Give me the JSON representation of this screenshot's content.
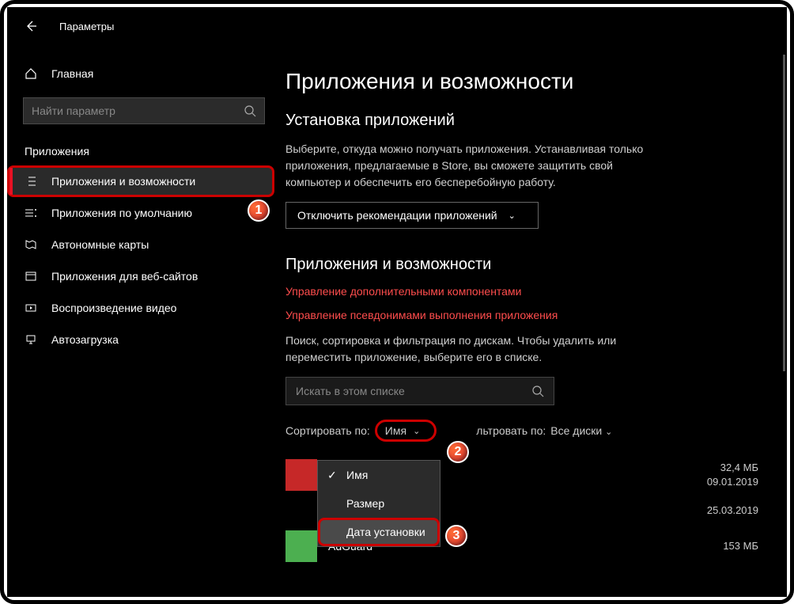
{
  "window": {
    "title": "Параметры"
  },
  "sidebar": {
    "home": "Главная",
    "search_placeholder": "Найти параметр",
    "section": "Приложения",
    "items": [
      {
        "label": "Приложения и возможности"
      },
      {
        "label": "Приложения по умолчанию"
      },
      {
        "label": "Автономные карты"
      },
      {
        "label": "Приложения для веб-сайтов"
      },
      {
        "label": "Воспроизведение видео"
      },
      {
        "label": "Автозагрузка"
      }
    ]
  },
  "main": {
    "title": "Приложения и возможности",
    "install": {
      "heading": "Установка приложений",
      "description": "Выберите, откуда можно получать приложения. Устанавливая только приложения, предлагаемые в Store, вы сможете защитить свой компьютер и обеспечить его бесперебойную работу.",
      "dropdown": "Отключить рекомендации приложений"
    },
    "apps": {
      "heading": "Приложения и возможности",
      "link1": "Управление дополнительными компонентами",
      "link2": "Управление псевдонимами выполнения приложения",
      "description": "Поиск, сортировка и фильтрация по дискам. Чтобы удалить или переместить приложение, выберите его в списке.",
      "search_placeholder": "Искать в этом списке",
      "sort_label": "Сортировать по:",
      "sort_value": "Имя",
      "filter_label": "льтровать по:",
      "filter_value": "Все диски"
    },
    "sort_menu": {
      "opt1": "Имя",
      "opt2": "Размер",
      "opt3": "Дата установки"
    },
    "app_list": [
      {
        "name": "",
        "size": "32,4 МБ",
        "date": "09.01.2019"
      },
      {
        "name": "",
        "size": "",
        "date": "25.03.2019"
      },
      {
        "name": "AdGuard",
        "size": "153 МБ",
        "date": ""
      }
    ]
  },
  "markers": {
    "m1": "1",
    "m2": "2",
    "m3": "3"
  }
}
